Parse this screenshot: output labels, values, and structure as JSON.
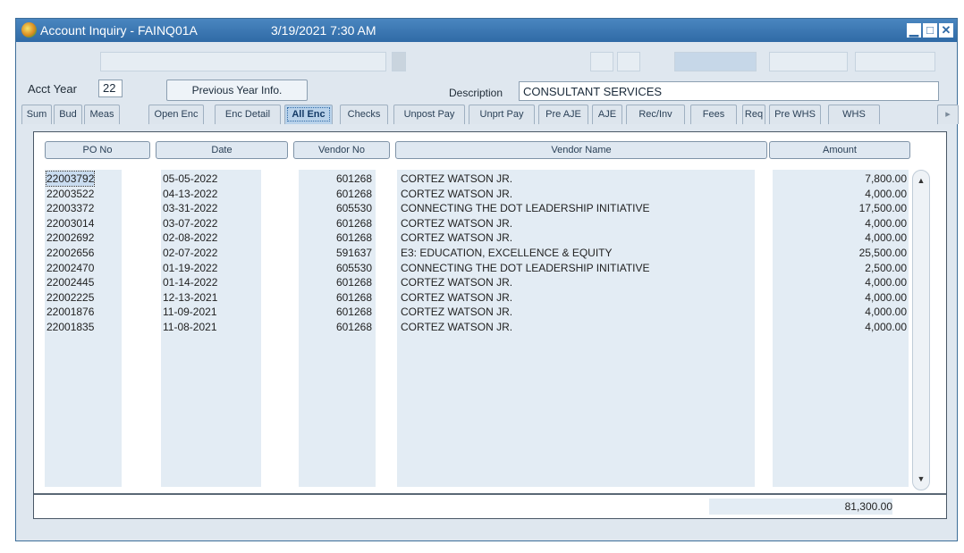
{
  "window": {
    "title": "Account Inquiry - FAINQ01A",
    "datetime": "3/19/2021 7:30 AM",
    "controls": [
      "minimize",
      "maximize",
      "close"
    ]
  },
  "form": {
    "acct_year_label": "Acct Year",
    "acct_year_value": "22",
    "prev_year_button": "Previous Year Info.",
    "description_label": "Description",
    "description_value": "CONSULTANT SERVICES"
  },
  "tabs": [
    "Sum",
    "Bud",
    "Meas",
    "Open Enc",
    "Enc Detail",
    "All Enc",
    "Checks",
    "Unpost Pay",
    "Unprt Pay",
    "Pre AJE",
    "AJE",
    "Rec/Inv",
    "Fees",
    "Req",
    "Pre WHS",
    "WHS"
  ],
  "active_tab": "All Enc",
  "table": {
    "columns": [
      "PO No",
      "Date",
      "Vendor No",
      "Vendor Name",
      "Amount"
    ],
    "rows": [
      {
        "po": "22003792",
        "date": "05-05-2022",
        "vendor_no": "601268",
        "vendor_name": "CORTEZ WATSON JR.",
        "amount": "7,800.00"
      },
      {
        "po": "22003522",
        "date": "04-13-2022",
        "vendor_no": "601268",
        "vendor_name": "CORTEZ WATSON JR.",
        "amount": "4,000.00"
      },
      {
        "po": "22003372",
        "date": "03-31-2022",
        "vendor_no": "605530",
        "vendor_name": "CONNECTING THE DOT LEADERSHIP INITIATIVE",
        "amount": "17,500.00"
      },
      {
        "po": "22003014",
        "date": "03-07-2022",
        "vendor_no": "601268",
        "vendor_name": "CORTEZ WATSON JR.",
        "amount": "4,000.00"
      },
      {
        "po": "22002692",
        "date": "02-08-2022",
        "vendor_no": "601268",
        "vendor_name": "CORTEZ WATSON JR.",
        "amount": "4,000.00"
      },
      {
        "po": "22002656",
        "date": "02-07-2022",
        "vendor_no": "591637",
        "vendor_name": "E3: EDUCATION, EXCELLENCE & EQUITY",
        "amount": "25,500.00"
      },
      {
        "po": "22002470",
        "date": "01-19-2022",
        "vendor_no": "605530",
        "vendor_name": "CONNECTING THE DOT LEADERSHIP INITIATIVE",
        "amount": "2,500.00"
      },
      {
        "po": "22002445",
        "date": "01-14-2022",
        "vendor_no": "601268",
        "vendor_name": "CORTEZ WATSON JR.",
        "amount": "4,000.00"
      },
      {
        "po": "22002225",
        "date": "12-13-2021",
        "vendor_no": "601268",
        "vendor_name": "CORTEZ WATSON JR.",
        "amount": "4,000.00"
      },
      {
        "po": "22001876",
        "date": "11-09-2021",
        "vendor_no": "601268",
        "vendor_name": "CORTEZ WATSON JR.",
        "amount": "4,000.00"
      },
      {
        "po": "22001835",
        "date": "11-08-2021",
        "vendor_no": "601268",
        "vendor_name": "CORTEZ WATSON JR.",
        "amount": "4,000.00"
      }
    ],
    "total": "81,300.00"
  },
  "colors": {
    "titlebar": "#2f6aa6",
    "active_tab": "#b9d2ea",
    "column_bg": "#e3ecf4"
  }
}
